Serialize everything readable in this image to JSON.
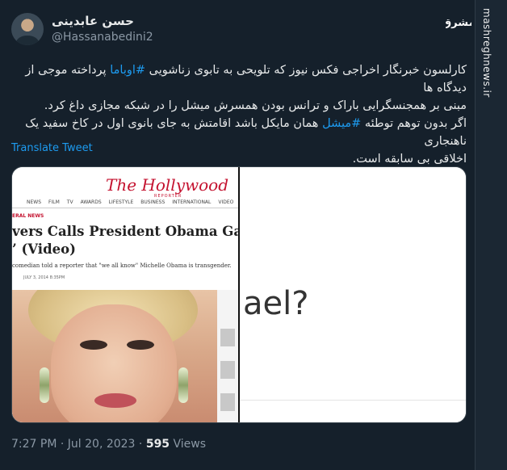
{
  "author": {
    "name": "حسن عابدینی",
    "handle": "@Hassanabedini2"
  },
  "branding": {
    "logo_text": "مشرق",
    "side_text": "mashreghnews.ir"
  },
  "tweet": {
    "line1_pre": "کارلسون خبرنگار اخراجی فکس نیوز که تلویحی به تابوی زناشویی ",
    "line1_hashtag": "#اوباما",
    "line1_post": " پرداخته موجی از دیدگاه ها",
    "line2": "مبنی بر همجنسگرایی باراک و ترانس بودن همسرش میشل را در شبکه مجازی داغ کرد.",
    "line3_pre": "اگر بدون توهم توطئه ",
    "line3_hashtag": "#میشل",
    "line3_post": " همان مایکل باشد اقامتش به جای بانوی اول در کاخ سفید یک ناهنجاری",
    "line4": "اخلاقی بی سابقه است."
  },
  "translate_label": "Translate Tweet",
  "media": {
    "left": {
      "logo": "The Hollywood",
      "logo_sub": "REPORTER",
      "nav": [
        "NEWS",
        "FILM",
        "TV",
        "AWARDS",
        "LIFESTYLE",
        "BUSINESS",
        "INTERNATIONAL",
        "VIDEO",
        "PO"
      ],
      "category": "ERAL NEWS",
      "headline_line1": "vers Calls President Obama Gay, Says",
      "headline_line2": "’ (Video)",
      "deck": "comedian told a reporter that \"we all know\" Michelle Obama is transgender.",
      "date": "JULY 3, 2014 8:35PM"
    },
    "right": {
      "text": "ael?"
    }
  },
  "meta": {
    "time": "7:27 PM",
    "separator": "·",
    "date": "Jul 20, 2023",
    "views_count": "595",
    "views_label": "Views"
  }
}
